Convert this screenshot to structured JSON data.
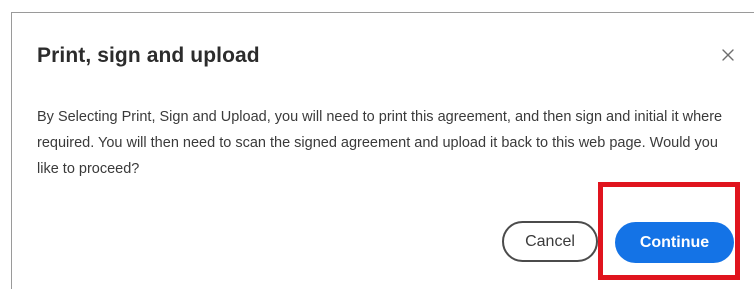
{
  "dialog": {
    "title": "Print, sign and upload",
    "message": "By Selecting Print, Sign and Upload, you will need to print this agreement, and then sign and initial it where required. You will then need to scan the signed agreement and upload it back to this web page. Would you like to proceed?",
    "close_icon": "close-icon",
    "cancel_label": "Cancel",
    "continue_label": "Continue"
  },
  "colors": {
    "primary": "#1473e6",
    "highlight": "#e0141e",
    "text": "#2c2c2c"
  }
}
